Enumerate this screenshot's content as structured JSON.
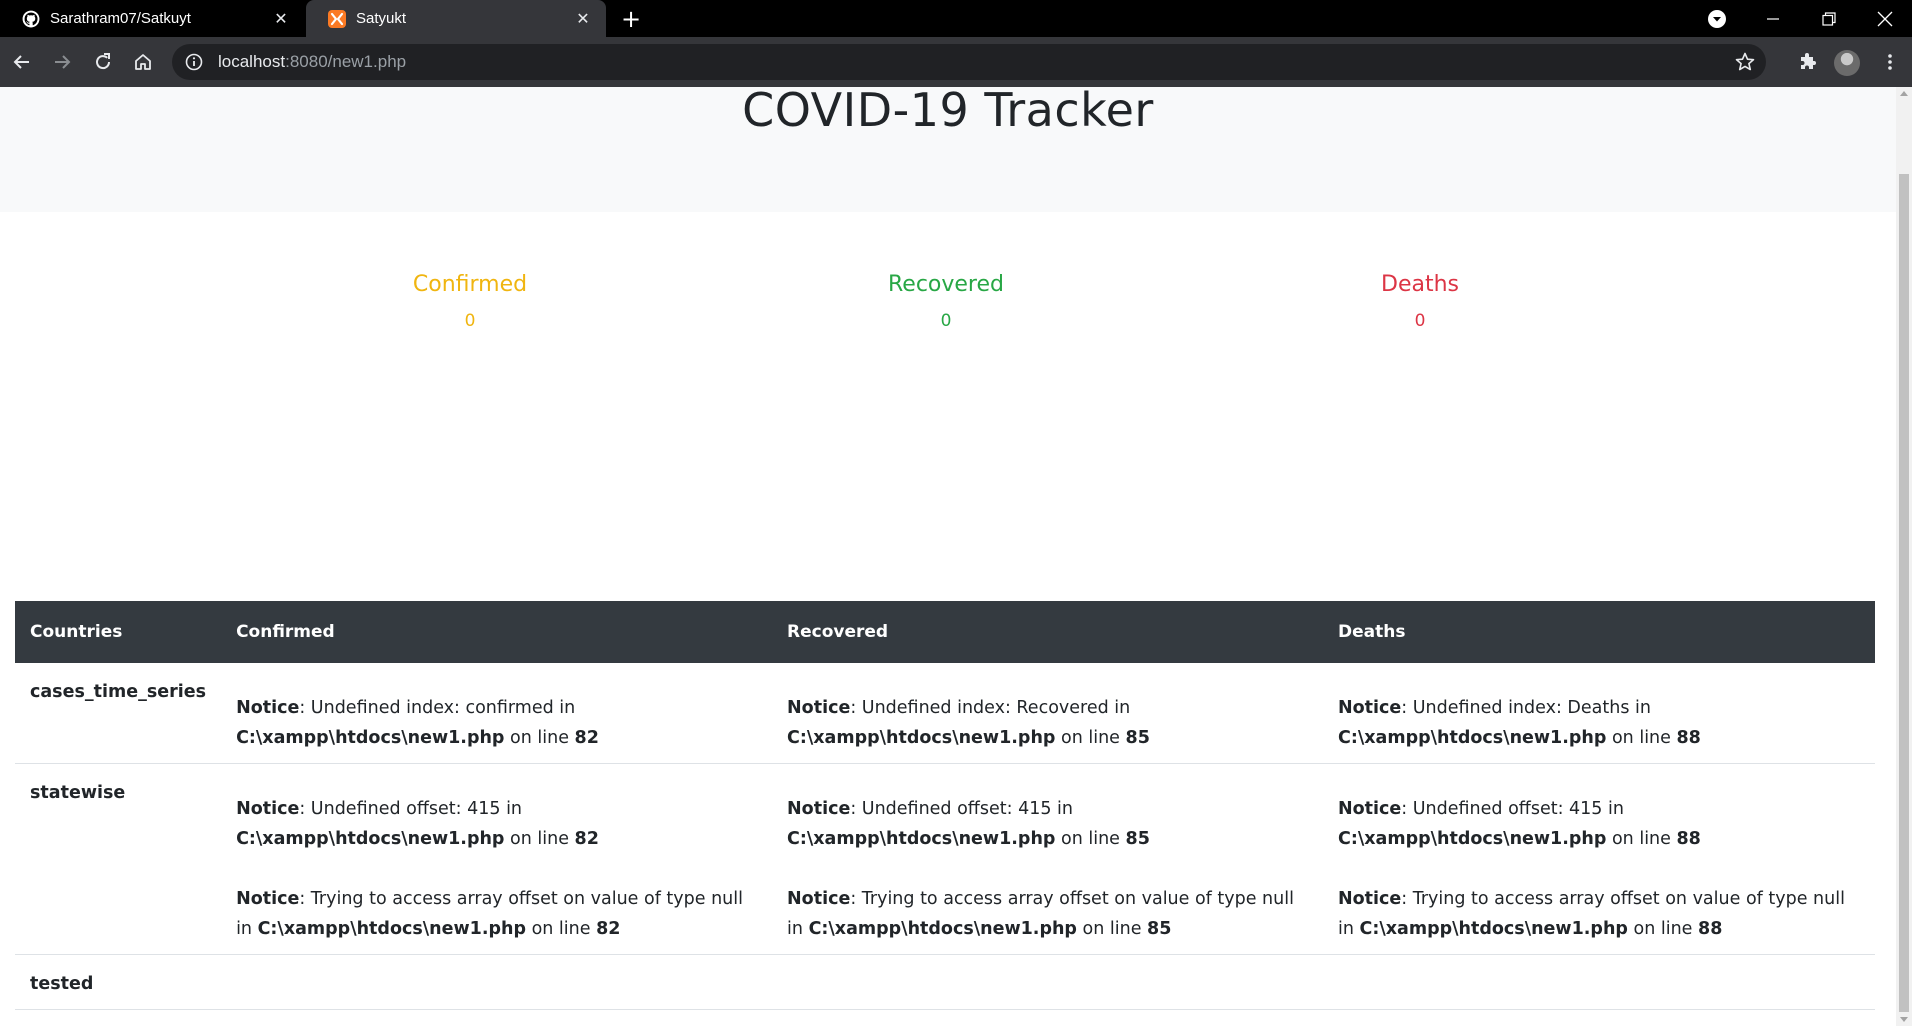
{
  "browser": {
    "tabs": [
      {
        "title": "Sarathram07/Satkuyt",
        "favicon": "github-icon",
        "active": false
      },
      {
        "title": "Satyukt",
        "favicon": "xampp-icon",
        "active": true
      }
    ],
    "url_host": "localhost",
    "url_rest": ":8080/new1.php"
  },
  "page": {
    "title": "COVID-19 Tracker",
    "stats": [
      {
        "label": "Confirmed",
        "value": "0",
        "color": "#ffc107"
      },
      {
        "label": "Recovered",
        "value": "0",
        "color": "#28a745"
      },
      {
        "label": "Deaths",
        "value": "0",
        "color": "#dc3545"
      }
    ],
    "table": {
      "headers": [
        "Countries",
        "Confirmed",
        "Recovered",
        "Deaths"
      ],
      "rows": [
        {
          "country": "cases_time_series",
          "cells": [
            [
              {
                "notice": "Notice",
                "msg": ": Undefined index: confirmed in ",
                "path": "C:\\xampp\\htdocs\\new1.php",
                "online": " on line ",
                "line": "82"
              }
            ],
            [
              {
                "notice": "Notice",
                "msg": ": Undefined index: Recovered in ",
                "path": "C:\\xampp\\htdocs\\new1.php",
                "online": " on line ",
                "line": "85"
              }
            ],
            [
              {
                "notice": "Notice",
                "msg": ": Undefined index: Deaths in ",
                "path": "C:\\xampp\\htdocs\\new1.php",
                "online": " on line ",
                "line": "88"
              }
            ]
          ]
        },
        {
          "country": "statewise",
          "cells": [
            [
              {
                "notice": "Notice",
                "msg": ": Undefined offset: 415 in ",
                "path": "C:\\xampp\\htdocs\\new1.php",
                "online": " on line ",
                "line": "82"
              },
              {
                "notice": "Notice",
                "msg": ": Trying to access array offset on value of type null in ",
                "path": "C:\\xampp\\htdocs\\new1.php",
                "online": " on line ",
                "line": "82"
              }
            ],
            [
              {
                "notice": "Notice",
                "msg": ": Undefined offset: 415 in ",
                "path": "C:\\xampp\\htdocs\\new1.php",
                "online": " on line ",
                "line": "85"
              },
              {
                "notice": "Notice",
                "msg": ": Trying to access array offset on value of type null in ",
                "path": "C:\\xampp\\htdocs\\new1.php",
                "online": " on line ",
                "line": "85"
              }
            ],
            [
              {
                "notice": "Notice",
                "msg": ": Undefined offset: 415 in ",
                "path": "C:\\xampp\\htdocs\\new1.php",
                "online": " on line ",
                "line": "88"
              },
              {
                "notice": "Notice",
                "msg": ": Trying to access array offset on value of type null in ",
                "path": "C:\\xampp\\htdocs\\new1.php",
                "online": " on line ",
                "line": "88"
              }
            ]
          ]
        },
        {
          "country": "tested",
          "cells": []
        }
      ]
    }
  }
}
